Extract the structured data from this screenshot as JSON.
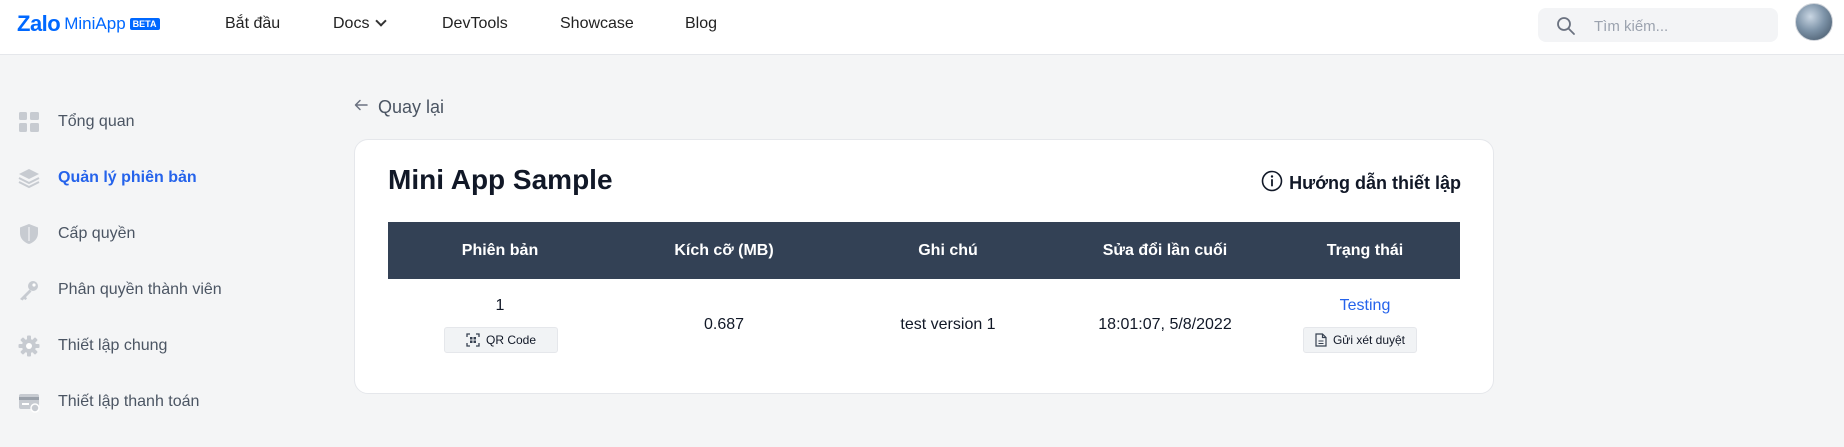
{
  "header": {
    "logo": {
      "brand": "Zalo",
      "product": "MiniApp",
      "badge": "BETA"
    },
    "nav": [
      {
        "label": "Bắt đầu"
      },
      {
        "label": "Docs"
      },
      {
        "label": "DevTools"
      },
      {
        "label": "Showcase"
      },
      {
        "label": "Blog"
      }
    ],
    "search": {
      "placeholder": "Tìm kiếm...",
      "value": ""
    }
  },
  "sidebar": {
    "items": [
      {
        "label": "Tổng quan",
        "icon": "grid-icon",
        "active": false
      },
      {
        "label": "Quản lý phiên bản",
        "icon": "layers-icon",
        "active": true
      },
      {
        "label": "Cấp quyền",
        "icon": "shield-icon",
        "active": false
      },
      {
        "label": "Phân quyền thành viên",
        "icon": "key-icon",
        "active": false
      },
      {
        "label": "Thiết lập chung",
        "icon": "gear-icon",
        "active": false
      },
      {
        "label": "Thiết lập thanh toán",
        "icon": "credit-card-icon",
        "active": false
      }
    ]
  },
  "main": {
    "back_label": "Quay lại",
    "app_title": "Mini App Sample",
    "guide_label": "Hướng dẫn thiết lập",
    "table": {
      "columns": [
        "Phiên bản",
        "Kích cỡ (MB)",
        "Ghi chú",
        "Sửa đổi lần cuối",
        "Trạng thái"
      ],
      "rows": [
        {
          "version": "1",
          "qr_label": "QR Code",
          "size": "0.687",
          "note": "test version 1",
          "modified": "18:01:07, 5/8/2022",
          "status": "Testing",
          "review_label": "Gửi xét duyệt"
        }
      ]
    }
  },
  "colors": {
    "brand": "#0068ff",
    "active": "#2563eb",
    "table_header": "#334155"
  }
}
